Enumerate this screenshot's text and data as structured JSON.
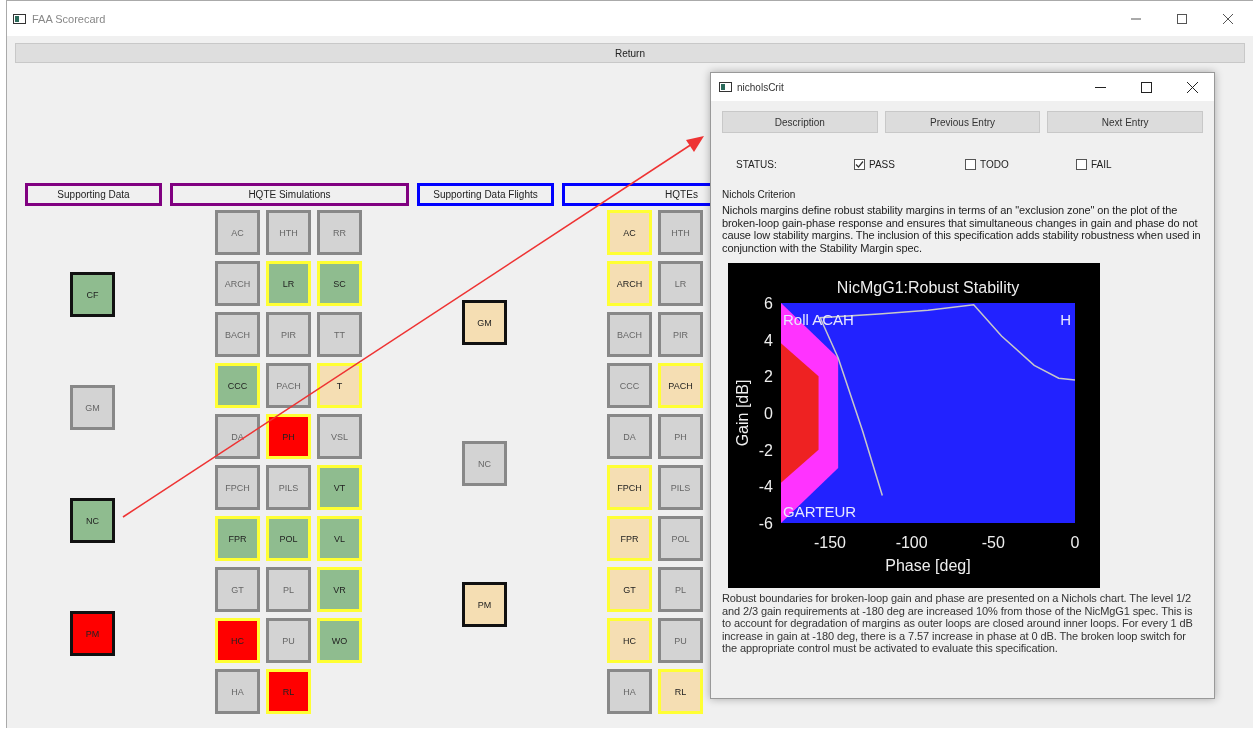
{
  "window": {
    "title": "FAA Scorecard"
  },
  "return_button": "Return",
  "sections": [
    {
      "title": "Supporting Data",
      "color": "#800080",
      "kind": "supporting",
      "rows": [
        [
          {
            "label": "CF",
            "color": "#8fbc8f",
            "disabled": false
          }
        ],
        [
          {
            "label": "GM",
            "color": "#d3d3d3",
            "disabled": true
          }
        ],
        [
          {
            "label": "NC",
            "color": "#8fbc8f",
            "disabled": false
          }
        ],
        [
          {
            "label": "PM",
            "color": "#ff0000",
            "disabled": false
          }
        ]
      ]
    },
    {
      "title": "HQTE Simulations",
      "color": "#800080",
      "kind": "hqte",
      "rows": [
        [
          {
            "label": "AC",
            "color": "#d3d3d3",
            "disabled": true
          },
          {
            "label": "HTH",
            "color": "#d3d3d3",
            "disabled": true
          },
          {
            "label": "RR",
            "color": "#d3d3d3",
            "disabled": true
          }
        ],
        [
          {
            "label": "ARCH",
            "color": "#d3d3d3",
            "disabled": true
          },
          {
            "label": "LR",
            "color": "#8fbc8f",
            "disabled": false
          },
          {
            "label": "SC",
            "color": "#8fbc8f",
            "disabled": false
          }
        ],
        [
          {
            "label": "BACH",
            "color": "#d3d3d3",
            "disabled": true
          },
          {
            "label": "PIR",
            "color": "#d3d3d3",
            "disabled": true
          },
          {
            "label": "TT",
            "color": "#d3d3d3",
            "disabled": true
          }
        ],
        [
          {
            "label": "CCC",
            "color": "#8fbc8f",
            "disabled": false
          },
          {
            "label": "PACH",
            "color": "#d3d3d3",
            "disabled": true
          },
          {
            "label": "T",
            "color": "#f5deb3",
            "disabled": false
          }
        ],
        [
          {
            "label": "DA",
            "color": "#d3d3d3",
            "disabled": true
          },
          {
            "label": "PH",
            "color": "#ff0000",
            "disabled": false
          },
          {
            "label": "VSL",
            "color": "#d3d3d3",
            "disabled": true
          }
        ],
        [
          {
            "label": "FPCH",
            "color": "#d3d3d3",
            "disabled": true
          },
          {
            "label": "PILS",
            "color": "#d3d3d3",
            "disabled": true
          },
          {
            "label": "VT",
            "color": "#8fbc8f",
            "disabled": false
          }
        ],
        [
          {
            "label": "FPR",
            "color": "#8fbc8f",
            "disabled": false
          },
          {
            "label": "POL",
            "color": "#8fbc8f",
            "disabled": false
          },
          {
            "label": "VL",
            "color": "#8fbc8f",
            "disabled": false
          }
        ],
        [
          {
            "label": "GT",
            "color": "#d3d3d3",
            "disabled": true
          },
          {
            "label": "PL",
            "color": "#d3d3d3",
            "disabled": true
          },
          {
            "label": "VR",
            "color": "#8fbc8f",
            "disabled": false
          }
        ],
        [
          {
            "label": "HC",
            "color": "#ff0000",
            "disabled": false
          },
          {
            "label": "PU",
            "color": "#d3d3d3",
            "disabled": true
          },
          {
            "label": "WO",
            "color": "#8fbc8f",
            "disabled": false
          }
        ],
        [
          {
            "label": "HA",
            "color": "#d3d3d3",
            "disabled": true
          },
          {
            "label": "RL",
            "color": "#ff0000",
            "disabled": false
          }
        ]
      ]
    },
    {
      "title": "Supporting Data Flights",
      "color": "#0000ff",
      "kind": "supporting",
      "rows": [
        [
          {
            "label": "GM",
            "color": "#f5deb3",
            "disabled": false
          }
        ],
        [
          {
            "label": "NC",
            "color": "#d3d3d3",
            "disabled": true
          }
        ],
        [
          {
            "label": "PM",
            "color": "#f5deb3",
            "disabled": false
          }
        ]
      ]
    },
    {
      "title": "HQTEs",
      "color": "#0000ff",
      "kind": "hqte",
      "rows": [
        [
          {
            "label": "AC",
            "color": "#f5deb3",
            "disabled": false
          },
          {
            "label": "HTH",
            "color": "#d3d3d3",
            "disabled": true
          }
        ],
        [
          {
            "label": "ARCH",
            "color": "#f5deb3",
            "disabled": false
          },
          {
            "label": "LR",
            "color": "#d3d3d3",
            "disabled": true
          }
        ],
        [
          {
            "label": "BACH",
            "color": "#d3d3d3",
            "disabled": true
          },
          {
            "label": "PIR",
            "color": "#d3d3d3",
            "disabled": true
          }
        ],
        [
          {
            "label": "CCC",
            "color": "#d3d3d3",
            "disabled": true
          },
          {
            "label": "PACH",
            "color": "#f5deb3",
            "disabled": false
          }
        ],
        [
          {
            "label": "DA",
            "color": "#d3d3d3",
            "disabled": true
          },
          {
            "label": "PH",
            "color": "#d3d3d3",
            "disabled": true
          }
        ],
        [
          {
            "label": "FPCH",
            "color": "#f5deb3",
            "disabled": false
          },
          {
            "label": "PILS",
            "color": "#d3d3d3",
            "disabled": true
          }
        ],
        [
          {
            "label": "FPR",
            "color": "#f5deb3",
            "disabled": false
          },
          {
            "label": "POL",
            "color": "#d3d3d3",
            "disabled": true
          }
        ],
        [
          {
            "label": "GT",
            "color": "#f5deb3",
            "disabled": false
          },
          {
            "label": "PL",
            "color": "#d3d3d3",
            "disabled": true
          }
        ],
        [
          {
            "label": "HC",
            "color": "#f5deb3",
            "disabled": false
          },
          {
            "label": "PU",
            "color": "#d3d3d3",
            "disabled": true
          }
        ],
        [
          {
            "label": "HA",
            "color": "#d3d3d3",
            "disabled": true
          },
          {
            "label": "RL",
            "color": "#f5deb3",
            "disabled": false
          }
        ]
      ]
    }
  ],
  "dialog": {
    "title": "nicholsCrit",
    "buttons": [
      "Description",
      "Previous Entry",
      "Next Entry"
    ],
    "status_label": "STATUS:",
    "status_options": [
      {
        "label": "PASS",
        "checked": true
      },
      {
        "label": "TODO",
        "checked": false
      },
      {
        "label": "FAIL",
        "checked": false
      }
    ],
    "heading": "Nichols Criterion",
    "description": "Nichols margins define robust stability margins in terms of an \"exclusion zone\" on the plot of the broken-loop gain-phase response and ensures that simultaneous changes in gain and phase do not cause low stability margins. The inclusion of this specification adds stability robustness when used in conjunction with the Stability Margin spec.",
    "chart_data": {
      "type": "line",
      "title": "NicMgG1:Robust Stability",
      "xlabel": "Phase [deg]",
      "ylabel": "Gain [dB]",
      "x": [
        -118,
        -130,
        -145,
        -156,
        -120,
        -90,
        -62,
        -45,
        -25,
        -10,
        0
      ],
      "series": [
        {
          "color": "#c8c8c8",
          "values": [
            -4.5,
            -1,
            3,
            5.2,
            5.4,
            5.6,
            5.9,
            4.2,
            2.6,
            1.9,
            1.8
          ]
        }
      ],
      "xlim": [
        -180,
        0
      ],
      "ylim": [
        -6,
        6
      ],
      "xticks": [
        -150,
        -100,
        -50,
        0
      ],
      "yticks": [
        -6,
        -4,
        -2,
        0,
        2,
        4,
        6
      ],
      "annotations": [
        "Roll ACAH",
        "H",
        "GARTEUR"
      ]
    },
    "footer": "Robust boundaries for broken-loop gain and phase are presented on a Nichols chart. The level 1/2 and 2/3 gain requirements at -180 deg are increased 10% from those of the NicMgG1 spec. This is to account for degradation of margins as outer loops are closed around inner loops. For every 1 dB increase in gain at -180 deg, there is a 7.57 increase in phase at 0 dB. The broken loop switch for the appropriate control must be activated to evaluate this specification."
  }
}
